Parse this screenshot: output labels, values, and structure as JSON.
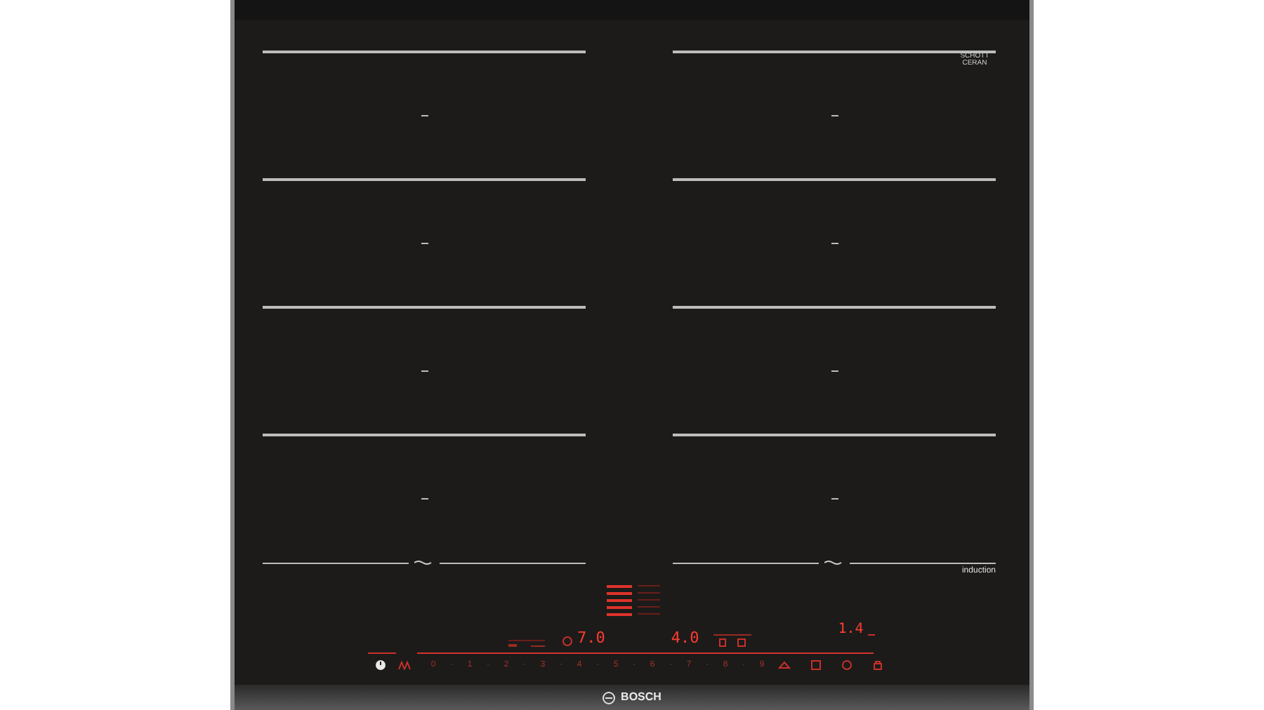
{
  "glass_label": "SCHOTT CERAN",
  "zone_label": "induction",
  "timer_displays": [
    {
      "value": "7.0"
    },
    {
      "value": "4.0"
    }
  ],
  "right_display": "1.4",
  "power_scale": [
    "0",
    "·",
    "1",
    "·",
    "2",
    "·",
    "3",
    "·",
    "4",
    "·",
    "5",
    "·",
    "6",
    "·",
    "7",
    "·",
    "8",
    "·",
    "9"
  ],
  "brand": "BOSCH"
}
